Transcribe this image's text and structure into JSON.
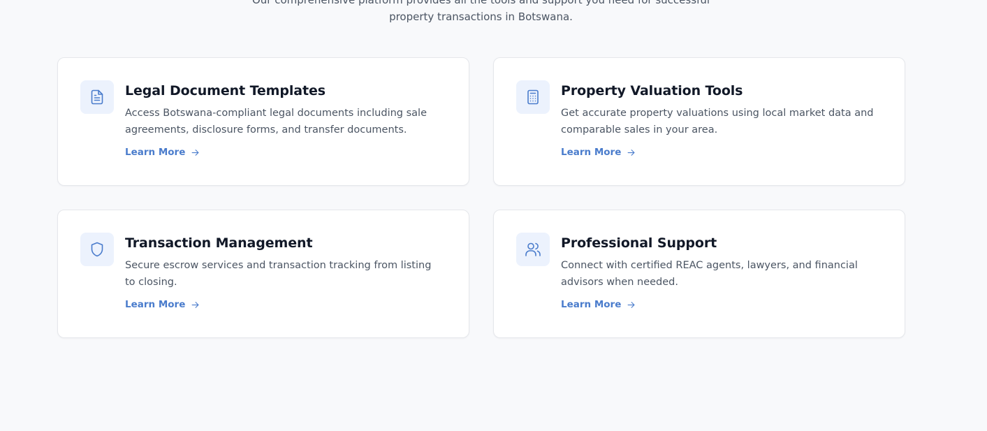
{
  "intro": {
    "line1": "Our comprehensive platform provides all the tools and support you need for successful",
    "line2": "property transactions in Botswana."
  },
  "colors": {
    "accent": "#4a7ccc",
    "icon_bg": "#ecf2fd",
    "page_bg": "#f8f9fb"
  },
  "cards": [
    {
      "icon": "document-icon",
      "title": "Legal Document Templates",
      "description": "Access Botswana-compliant legal documents including sale agreements, disclosure forms, and transfer documents.",
      "link": "Learn More"
    },
    {
      "icon": "calculator-icon",
      "title": "Property Valuation Tools",
      "description": "Get accurate property valuations using local market data and comparable sales in your area.",
      "link": "Learn More"
    },
    {
      "icon": "shield-icon",
      "title": "Transaction Management",
      "description": "Secure escrow services and transaction tracking from listing to closing.",
      "link": "Learn More"
    },
    {
      "icon": "users-icon",
      "title": "Professional Support",
      "description": "Connect with certified REAC agents, lawyers, and financial advisors when needed.",
      "link": "Learn More"
    }
  ]
}
